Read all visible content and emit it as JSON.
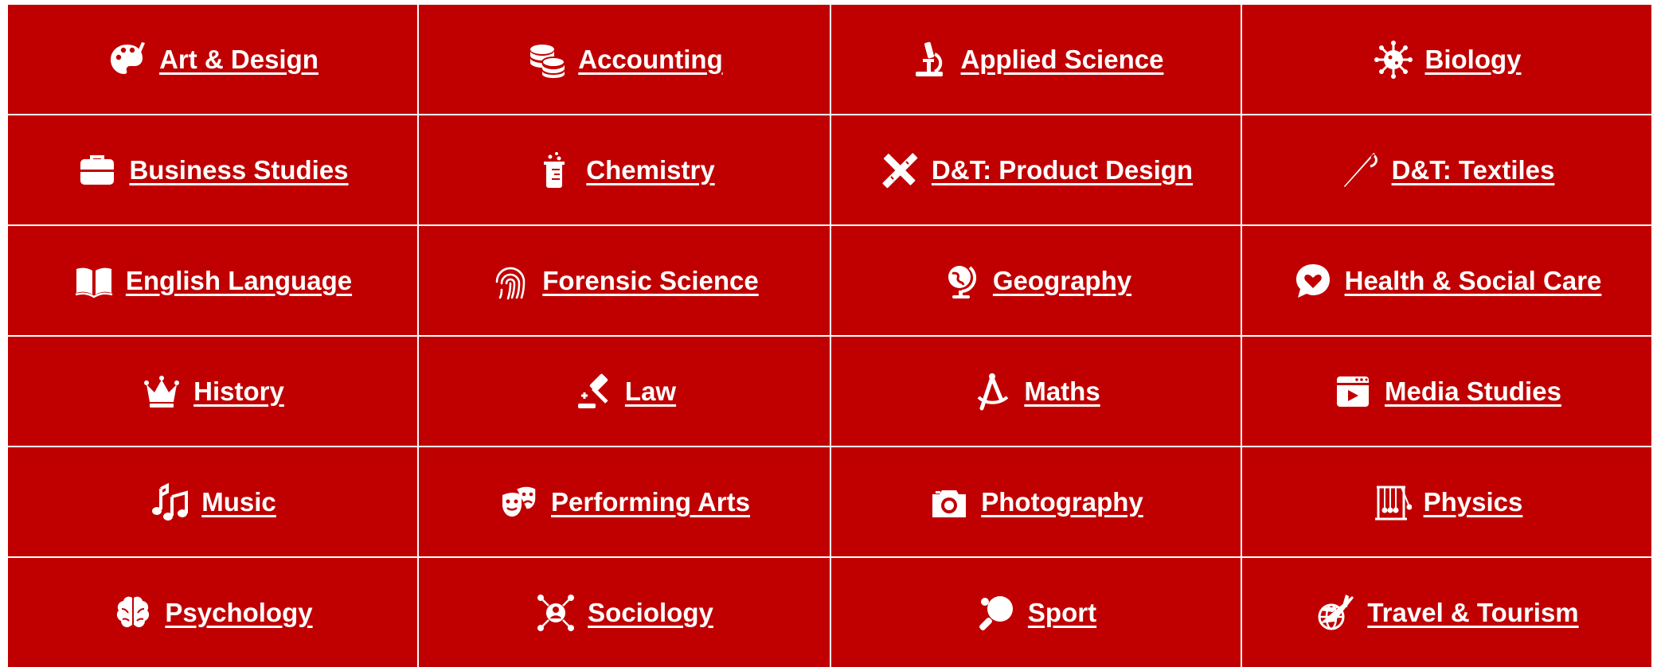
{
  "theme": {
    "cell_bg": "#c00000",
    "text_color": "#ffffff",
    "grid_line": "#ffffff"
  },
  "subjects": [
    {
      "label": "Art & Design",
      "icon": "palette-icon"
    },
    {
      "label": "Accounting",
      "icon": "coins-icon"
    },
    {
      "label": "Applied Science",
      "icon": "microscope-icon"
    },
    {
      "label": "Biology",
      "icon": "virus-icon"
    },
    {
      "label": "Business Studies",
      "icon": "briefcase-icon"
    },
    {
      "label": "Chemistry",
      "icon": "beaker-icon"
    },
    {
      "label": "D&T: Product Design",
      "icon": "pencil-ruler-icon"
    },
    {
      "label": "D&T: Textiles",
      "icon": "needle-icon"
    },
    {
      "label": "English Language",
      "icon": "book-icon"
    },
    {
      "label": "Forensic Science",
      "icon": "fingerprint-icon"
    },
    {
      "label": "Geography",
      "icon": "globe-icon"
    },
    {
      "label": "Health & Social Care",
      "icon": "heart-chat-icon"
    },
    {
      "label": "History",
      "icon": "crown-icon"
    },
    {
      "label": "Law",
      "icon": "gavel-icon"
    },
    {
      "label": "Maths",
      "icon": "compass-icon"
    },
    {
      "label": "Media Studies",
      "icon": "video-icon"
    },
    {
      "label": "Music",
      "icon": "music-icon"
    },
    {
      "label": "Performing Arts",
      "icon": "masks-icon"
    },
    {
      "label": "Photography",
      "icon": "camera-icon"
    },
    {
      "label": "Physics",
      "icon": "newtons-cradle-icon"
    },
    {
      "label": "Psychology",
      "icon": "brain-icon"
    },
    {
      "label": "Sociology",
      "icon": "network-icon"
    },
    {
      "label": "Sport",
      "icon": "ping-pong-icon"
    },
    {
      "label": "Travel & Tourism",
      "icon": "plane-globe-icon"
    }
  ]
}
